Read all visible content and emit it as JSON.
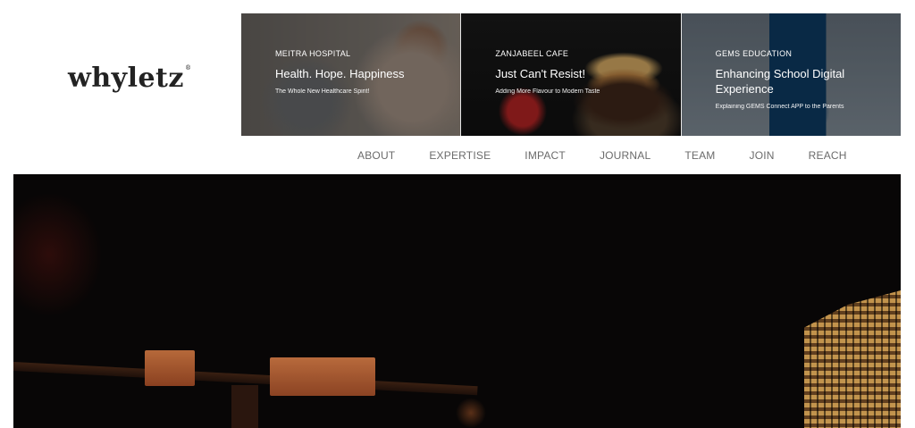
{
  "brand": {
    "logo_text": "whyletz",
    "logo_mark": "®"
  },
  "cards": [
    {
      "eyebrow": "MEITRA HOSPITAL",
      "title": "Health. Hope. Happiness",
      "subtitle": "The Whole New Healthcare Spirit!"
    },
    {
      "eyebrow": "ZANJABEEL CAFE",
      "title": "Just Can't Resist!",
      "subtitle": "Adding More Flavour to Modern Taste"
    },
    {
      "eyebrow": "GEMS EDUCATION",
      "title": "Enhancing School Digital Experience",
      "subtitle": "Explaining GEMS Connect APP to the Parents"
    }
  ],
  "nav": {
    "items": [
      "ABOUT",
      "EXPERTISE",
      "IMPACT",
      "JOURNAL",
      "TEAM",
      "JOIN",
      "REACH"
    ]
  }
}
